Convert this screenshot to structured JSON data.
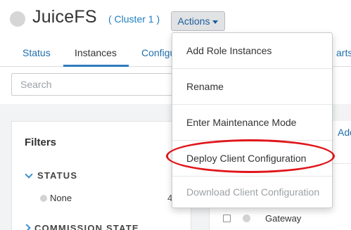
{
  "header": {
    "title": "JuiceFS",
    "cluster_link": "( Cluster 1 )",
    "actions_label": "Actions",
    "status_color": "#d6d6d6"
  },
  "tabs": [
    {
      "label": "Status",
      "active": false
    },
    {
      "label": "Instances",
      "active": true
    },
    {
      "label": "Configu",
      "active": false
    },
    {
      "label": "arts",
      "active": false
    }
  ],
  "search": {
    "placeholder": "Search",
    "value": ""
  },
  "filters": {
    "title": "Filters",
    "status_heading": "STATUS",
    "status_option": {
      "label": "None",
      "count": "4"
    },
    "commission_heading": "COMMISSION STATE"
  },
  "instances_table": {
    "add_label": "Add",
    "rows": [
      {
        "role": "Gateway"
      }
    ]
  },
  "actions_menu": {
    "items": [
      {
        "label": "Add Role Instances",
        "enabled": true
      },
      {
        "label": "Rename",
        "enabled": true
      },
      {
        "label": "Enter Maintenance Mode",
        "enabled": true
      },
      {
        "label": "Deploy Client Configuration",
        "enabled": true,
        "highlighted": true
      },
      {
        "label": "Download Client Configuration",
        "enabled": false
      }
    ]
  },
  "colors": {
    "link": "#1f7fc2",
    "annotation": "#e0161b",
    "active_tab_underline": "#2f7bbf"
  }
}
